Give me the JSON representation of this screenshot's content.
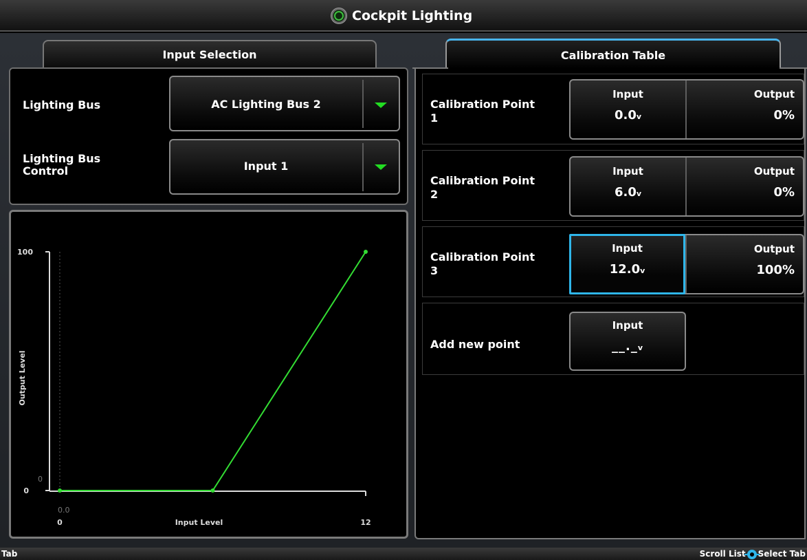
{
  "window": {
    "title": "Cockpit Lighting",
    "icon": "cockpit-lighting-icon"
  },
  "tabs": {
    "input_selection": "Input Selection",
    "calibration_table": "Calibration Table",
    "active": "Calibration Table"
  },
  "input_selection": {
    "lighting_bus": {
      "label": "Lighting Bus",
      "value": "AC Lighting Bus 2"
    },
    "lighting_bus_control": {
      "label": "Lighting Bus Control",
      "value": "Input 1"
    }
  },
  "calibration": {
    "points": [
      {
        "label": "Calibration Point",
        "number": "1",
        "input_header": "Input",
        "input_value": "0.0",
        "input_unit": "v",
        "output_header": "Output",
        "output_value": "0%"
      },
      {
        "label": "Calibration Point",
        "number": "2",
        "input_header": "Input",
        "input_value": "6.0",
        "input_unit": "v",
        "output_header": "Output",
        "output_value": "0%"
      },
      {
        "label": "Calibration Point",
        "number": "3",
        "input_header": "Input",
        "input_value": "12.0",
        "input_unit": "v",
        "output_header": "Output",
        "output_value": "100%"
      }
    ],
    "new_point": {
      "label": "Add new point",
      "input_header": "Input",
      "input_value": "__._",
      "input_unit": "v"
    }
  },
  "chart_data": {
    "type": "line",
    "xlabel": "Input Level",
    "ylabel": "Output Level",
    "xlim": [
      0,
      12
    ],
    "ylim": [
      0,
      100
    ],
    "x_ticks": [
      "0",
      "12"
    ],
    "y_ticks": [
      "0",
      "100"
    ],
    "x_range_label": "0.0",
    "y_range_label": "0",
    "series": [
      {
        "x": [
          0,
          6,
          12
        ],
        "y": [
          0,
          0,
          100
        ],
        "color": "#33dd33"
      }
    ]
  },
  "statusbar": {
    "left": "Tab",
    "scroll": "Scroll List",
    "select": "Select Tab"
  },
  "colors": {
    "accent": "#2fb6ea",
    "line": "#33dd33",
    "dropdown_arrow": "#22dd22"
  }
}
